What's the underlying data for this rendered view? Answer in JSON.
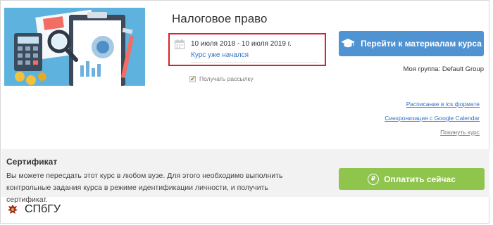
{
  "course": {
    "title": "Налоговое право",
    "dates": "10 июля 2018 - 10 июля 2019 г.",
    "status": "Курс уже начался",
    "subscribe_label": "Получать рассылку",
    "subscribed": true
  },
  "actions": {
    "materials_button": "Перейти к материалам курса",
    "group": "Моя группа: Default Group",
    "links": [
      {
        "label": "Расписание в ics формате"
      },
      {
        "label": "Синхронизация с Google Calendar"
      },
      {
        "label": "Покинуть курс"
      }
    ]
  },
  "certificate": {
    "title": "Сертификат",
    "text": "Вы можете пересдать этот курс в любом вузе. Для этого необходимо выполнить контрольные задания курса в режиме идентификации личности, и получить сертификат.",
    "pay_button": "Оплатить сейчас",
    "pay_icon_glyph": "₽"
  },
  "university": {
    "name": "СПбГУ"
  },
  "colors": {
    "materials_button": "#4f93d2",
    "pay_button": "#8fc54c",
    "highlight_border": "#d9222a",
    "link": "#2f72c4",
    "illustration_bg": "#5eb2de"
  }
}
